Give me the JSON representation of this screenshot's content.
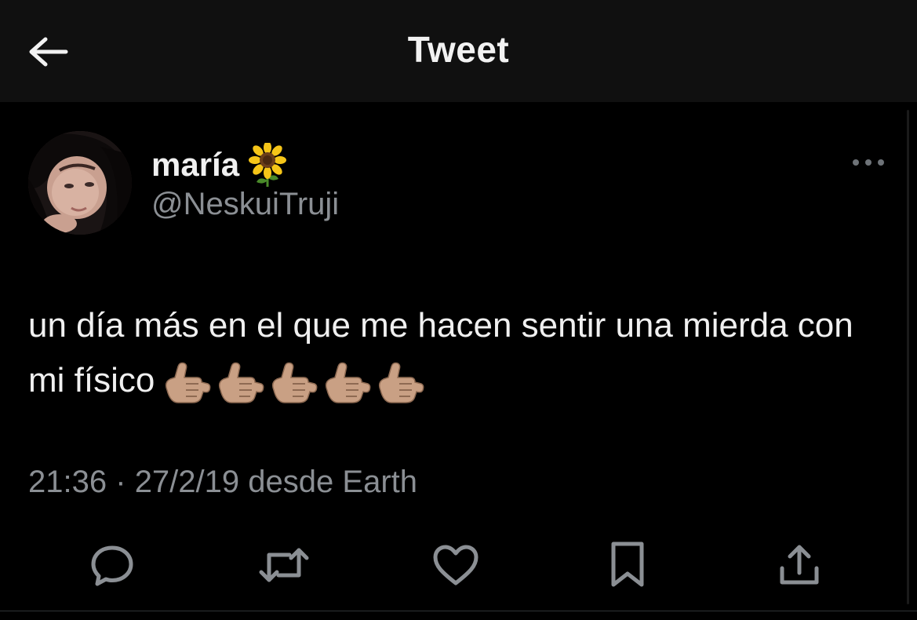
{
  "header": {
    "back_icon": "arrow-left-icon",
    "title": "Tweet"
  },
  "tweet": {
    "display_name": "maría",
    "name_emoji": "sunflower-icon",
    "handle": "@NeskuiTruji",
    "text": "un día más en el que me hacen sentir una mierda con mi físico",
    "emojis": [
      "call-me-hand-icon",
      "call-me-hand-icon",
      "call-me-hand-icon",
      "call-me-hand-icon",
      "call-me-hand-icon"
    ],
    "time": "21:36",
    "separator": "·",
    "date": "27/2/19",
    "source_prefix": "desde",
    "source": "Earth"
  },
  "actions": [
    "reply-icon",
    "retweet-icon",
    "like-icon",
    "bookmark-icon",
    "share-icon"
  ],
  "colors": {
    "background": "#000000",
    "header_bg": "#101010",
    "text": "#f0f0f0",
    "secondary_text": "#8b8f94",
    "skin_tone": "#c9a084"
  }
}
